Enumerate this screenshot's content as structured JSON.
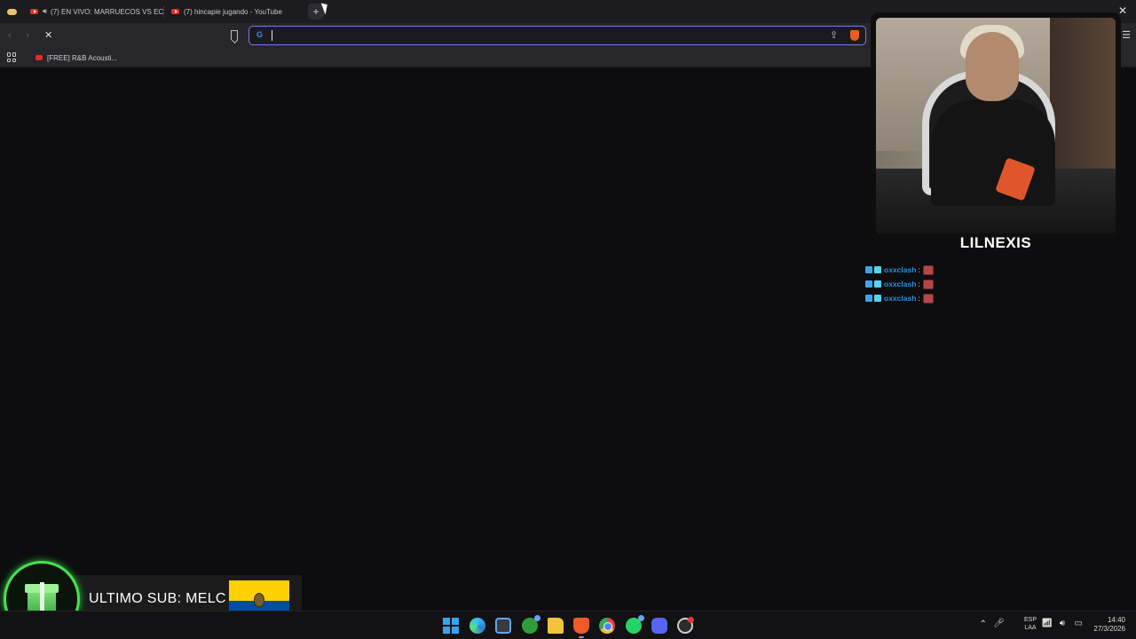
{
  "browser": {
    "tabs": [
      {
        "label": "(7) EN VIVO: MARRUECOS VS EC",
        "audio_playing": true,
        "favicon": "youtube-icon"
      },
      {
        "label": "(7) hincapie jugando - YouTube",
        "audio_playing": false,
        "favicon": "youtube-icon"
      }
    ],
    "new_tab_label": "+",
    "close_label": "✕",
    "toolbar": {
      "back": "‹",
      "forward": "›",
      "stop": "✕",
      "address_value": "",
      "address_placeholder": "",
      "search_engine_icon": "G"
    },
    "bookmarks": [
      {
        "label": "[FREE] R&B Acousti..."
      }
    ],
    "accent_color": "#7b76ea"
  },
  "stream_overlay": {
    "streamer_name": "LILNEXIS",
    "chat": [
      {
        "user": "oxxclash",
        "separator": ":",
        "message_emote": "emote"
      },
      {
        "user": "oxxclash",
        "separator": ":",
        "message_emote": "emote"
      },
      {
        "user": "oxxclash",
        "separator": ":",
        "message_emote": "emote"
      }
    ],
    "last_sub": {
      "text": "ULTIMO SUB: MELC",
      "ring_color": "#49e04f"
    }
  },
  "taskbar": {
    "apps": [
      "start",
      "edge",
      "store",
      "xbox",
      "file-explorer",
      "brave",
      "chrome",
      "whatsapp",
      "discord",
      "obs"
    ],
    "tray": {
      "chevron": "⌃",
      "lang_line1": "ESP",
      "lang_line2": "LAA",
      "time": "14:40",
      "date": "27/3/2026"
    }
  }
}
